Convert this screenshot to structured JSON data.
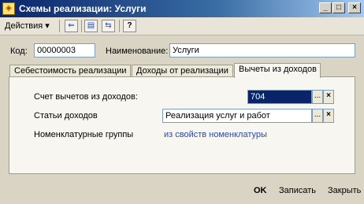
{
  "window": {
    "title": "Схемы реализации: Услуги",
    "app_icon": "1c-app-icon",
    "title_buttons": {
      "minimize": "_",
      "maximize": "□",
      "close": "×"
    }
  },
  "toolbar": {
    "actions_label": "Действия",
    "actions_arrow": "▾",
    "icons": {
      "back": "⇐",
      "structure": "▤",
      "refresh": "⇆",
      "help": "?"
    }
  },
  "header": {
    "code_label": "Код:",
    "code_value": "00000003",
    "name_label": "Наименование:",
    "name_value": "Услуги"
  },
  "tabs": [
    {
      "label": "Себестоимость реализации",
      "active": false
    },
    {
      "label": "Доходы от реализации",
      "active": false
    },
    {
      "label": "Вычеты из доходов",
      "active": true
    }
  ],
  "panel": {
    "deduction_account_label": "Счет вычетов из доходов:",
    "deduction_account_value": "704",
    "income_items_label": "Статьи доходов",
    "income_items_value": "Реализация услуг и работ",
    "nomenclature_groups_label": "Номенклатурные группы",
    "nomenclature_groups_value": "из свойств номенклатуры",
    "select_button": "...",
    "clear_button": "×"
  },
  "footer": {
    "ok": "OK",
    "save": "Записать",
    "close": "Закрыть"
  }
}
